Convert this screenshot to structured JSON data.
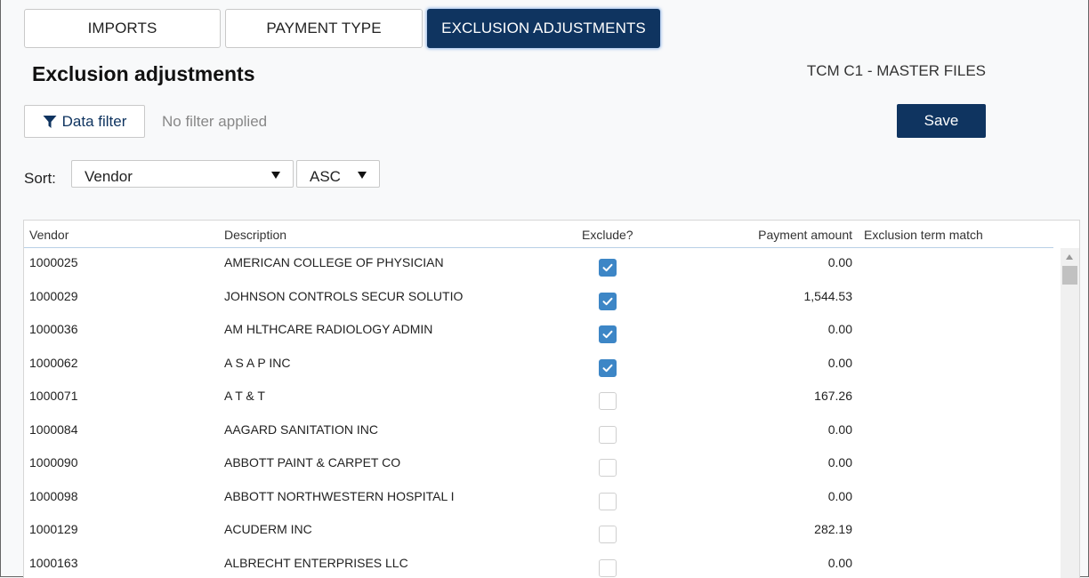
{
  "tabs": [
    {
      "label": "IMPORTS",
      "active": false
    },
    {
      "label": "PAYMENT TYPE",
      "active": false
    },
    {
      "label": "EXCLUSION ADJUSTMENTS",
      "active": true
    }
  ],
  "page": {
    "title": "Exclusion adjustments",
    "file_label": "TCM C1 - MASTER FILES"
  },
  "toolbar": {
    "filter_label": "Data filter",
    "filter_icon": "funnel-icon",
    "filter_status": "No filter applied",
    "save_label": "Save"
  },
  "sort": {
    "label": "Sort:",
    "field": "Vendor",
    "direction": "ASC"
  },
  "table": {
    "columns": [
      "Vendor",
      "Description",
      "Exclude?",
      "Payment amount",
      "Exclusion term match"
    ],
    "rows": [
      {
        "vendor": "1000025",
        "description": "AMERICAN COLLEGE OF PHYSICIAN",
        "exclude": true,
        "amount": "0.00",
        "term": ""
      },
      {
        "vendor": "1000029",
        "description": "JOHNSON CONTROLS SECUR SOLUTIO",
        "exclude": true,
        "amount": "1,544.53",
        "term": ""
      },
      {
        "vendor": "1000036",
        "description": "AM HLTHCARE RADIOLOGY ADMIN",
        "exclude": true,
        "amount": "0.00",
        "term": ""
      },
      {
        "vendor": "1000062",
        "description": "A S A P INC",
        "exclude": true,
        "amount": "0.00",
        "term": ""
      },
      {
        "vendor": "1000071",
        "description": "A T & T",
        "exclude": false,
        "amount": "167.26",
        "term": ""
      },
      {
        "vendor": "1000084",
        "description": "AAGARD SANITATION INC",
        "exclude": false,
        "amount": "0.00",
        "term": ""
      },
      {
        "vendor": "1000090",
        "description": "ABBOTT PAINT & CARPET CO",
        "exclude": false,
        "amount": "0.00",
        "term": ""
      },
      {
        "vendor": "1000098",
        "description": "ABBOTT NORTHWESTERN HOSPITAL I",
        "exclude": false,
        "amount": "0.00",
        "term": ""
      },
      {
        "vendor": "1000129",
        "description": "ACUDERM INC",
        "exclude": false,
        "amount": "282.19",
        "term": ""
      },
      {
        "vendor": "1000163",
        "description": "ALBRECHT ENTERPRISES LLC",
        "exclude": false,
        "amount": "0.00",
        "term": ""
      }
    ]
  },
  "colors": {
    "primary": "#0f3460",
    "checkbox_on": "#3d86c6"
  }
}
